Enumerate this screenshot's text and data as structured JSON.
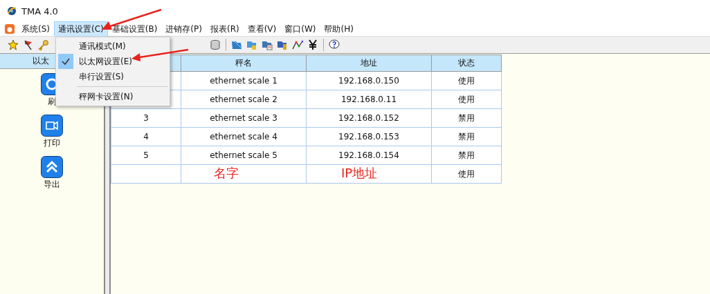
{
  "window": {
    "title": "TMA 4.0"
  },
  "menu_bar": [
    {
      "label": "系统(S)",
      "selected": false
    },
    {
      "label": "通讯设置(C)",
      "selected": true
    },
    {
      "label": "基础设置(B)",
      "selected": false
    },
    {
      "label": "进销存(P)",
      "selected": false
    },
    {
      "label": "报表(R)",
      "selected": false
    },
    {
      "label": "查看(V)",
      "selected": false
    },
    {
      "label": "窗口(W)",
      "selected": false
    },
    {
      "label": "帮助(H)",
      "selected": false
    }
  ],
  "dropdown": [
    {
      "label": "通讯模式(M)",
      "checked": false
    },
    {
      "label": "以太网设置(E)",
      "checked": true
    },
    {
      "label": "串行设置(S)",
      "checked": false
    },
    {
      "kind": "separator"
    },
    {
      "label": "秤网卡设置(N)",
      "checked": false
    }
  ],
  "sidebar": {
    "header": "以太",
    "buttons": [
      {
        "label": "刷",
        "kind": "refresh"
      },
      {
        "label": "打印",
        "kind": "print"
      },
      {
        "label": "导出",
        "kind": "export"
      }
    ]
  },
  "table": {
    "columns": [
      "秤名",
      "地址",
      "状态"
    ],
    "rows": [
      {
        "name": "ethernet scale 1",
        "address": "192.168.0.150",
        "status": "使用"
      },
      {
        "name": "ethernet scale 2",
        "address": "192.168.0.11",
        "status": "使用"
      },
      {
        "no": "3",
        "name": "ethernet scale 3",
        "address": "192.168.0.152",
        "status": "禁用"
      },
      {
        "no": "4",
        "name": "ethernet scale 4",
        "address": "192.168.0.153",
        "status": "禁用"
      },
      {
        "no": "5",
        "name": "ethernet scale 5",
        "address": "192.168.0.154",
        "status": "禁用"
      },
      {
        "status": "使用"
      }
    ]
  },
  "annotations": [
    "名字",
    "IP地址"
  ]
}
